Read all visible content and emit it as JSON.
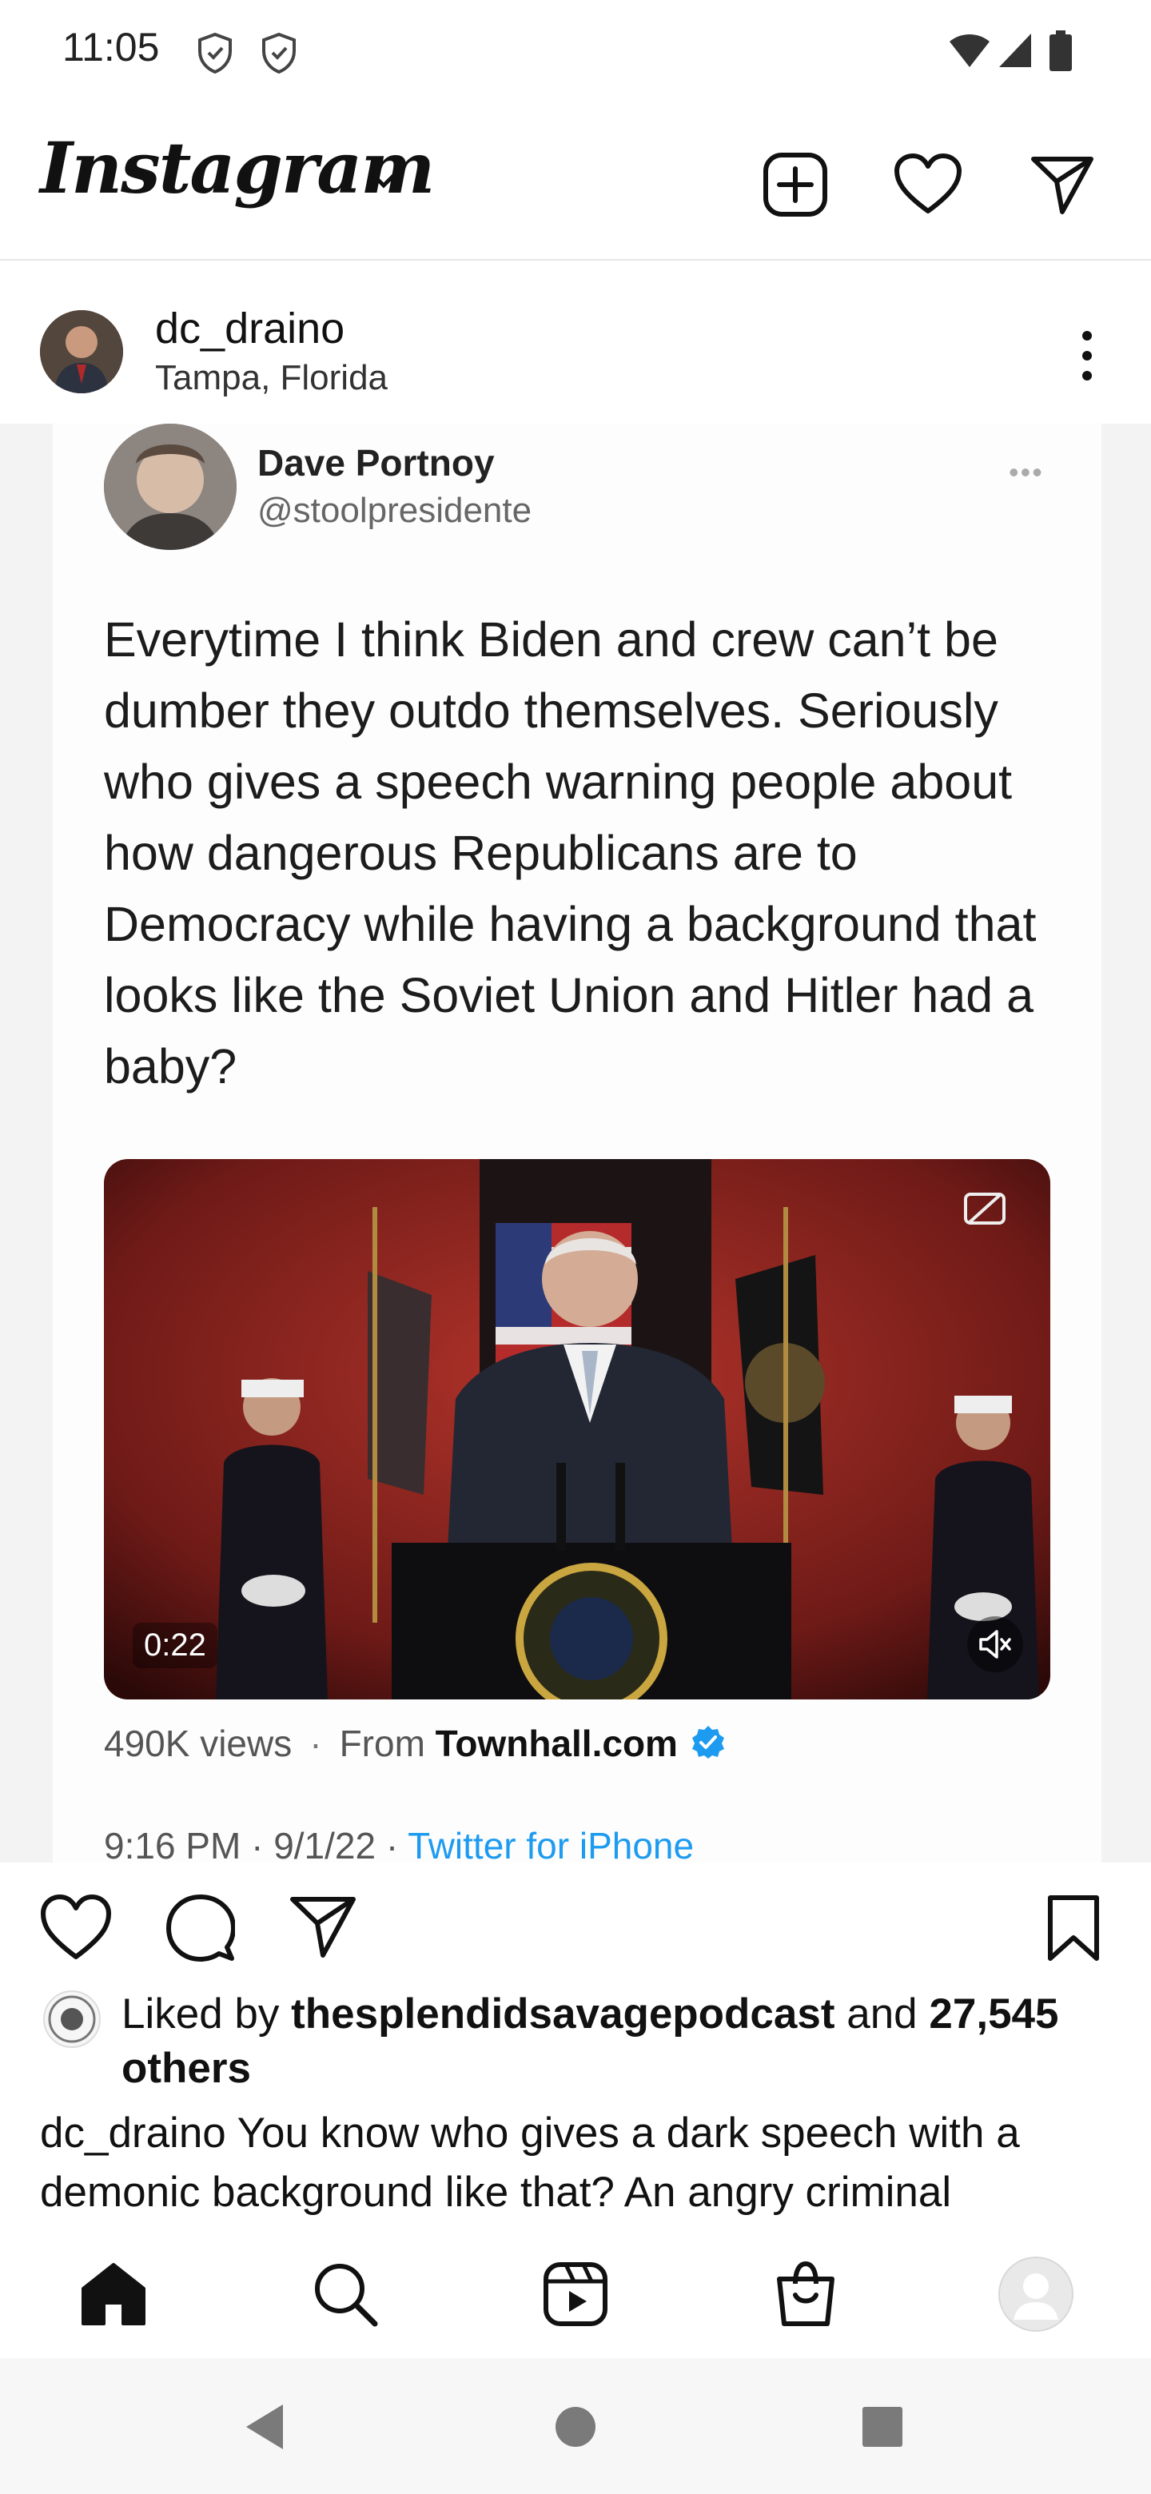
{
  "status_bar": {
    "time": "11:05",
    "icons": [
      "shield-icon",
      "shield-icon",
      "wifi-icon",
      "signal-icon",
      "battery-icon"
    ]
  },
  "header": {
    "logo": "Instagram",
    "actions": [
      "new-post-icon",
      "heart-icon",
      "direct-message-icon"
    ]
  },
  "post": {
    "username": "dc_draino",
    "location": "Tampa, Florida",
    "tweet": {
      "name": "Dave Portnoy",
      "handle": "@stoolpresidente",
      "more": "•••",
      "text": "Everytime I think Biden and crew can’t be dumber they outdo themselves. Seriously who gives a speech warning people about how dangerous Republicans are to Democracy while having a background that looks like the Soviet Union and Hitler had a baby?",
      "video_duration": "0:22",
      "views": "490K views",
      "separator": "·",
      "from_label": "From",
      "source": "Townhall.com",
      "time": "9:16 PM · 9/1/22 ·",
      "client": "Twitter for iPhone"
    },
    "likes": {
      "prefix": "Liked by",
      "liker": "thesplendidsavagepodcast",
      "middle": "and",
      "count": "27,545",
      "suffix": "others"
    },
    "caption": {
      "username": "dc_draino",
      "text": "You know who gives a dark speech with a demonic background like that? An angry criminal"
    }
  },
  "bottom_nav": [
    "home-icon",
    "search-icon",
    "reels-icon",
    "shop-icon",
    "profile-icon"
  ],
  "colors": {
    "link_blue": "#1d9bf0",
    "text": "#111111",
    "video_red": "#8a1f1c"
  }
}
